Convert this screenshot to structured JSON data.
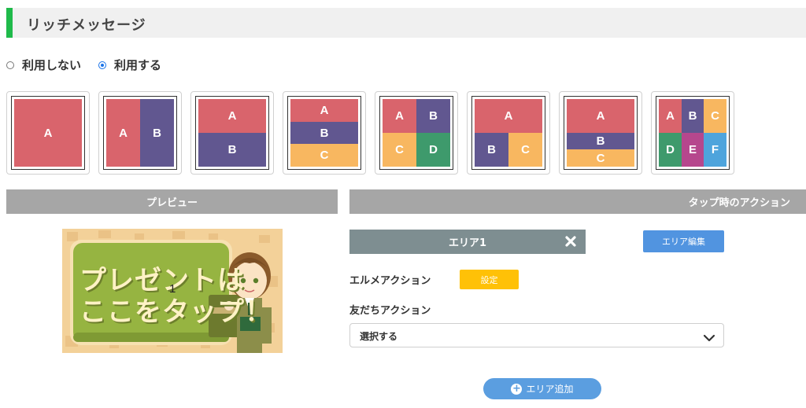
{
  "header": {
    "title": "リッチメッセージ",
    "accent_color": "#1fba4a"
  },
  "mode": {
    "options": [
      {
        "label": "利用しない",
        "checked": false
      },
      {
        "label": "利用する",
        "checked": true
      }
    ]
  },
  "layouts": {
    "colors": {
      "red": "#d9646c",
      "purple": "#615790",
      "orange": "#f8b760",
      "green": "#3e9a6c",
      "magenta": "#b6478d",
      "blue": "#4ea4dc"
    },
    "items": [
      {
        "tiles": [
          "A"
        ]
      },
      {
        "tiles": [
          "A",
          "B"
        ]
      },
      {
        "tiles": [
          "A",
          "B"
        ]
      },
      {
        "tiles": [
          "A",
          "B",
          "C"
        ]
      },
      {
        "tiles": [
          "A",
          "B",
          "C",
          "D"
        ]
      },
      {
        "tiles": [
          "A",
          "B",
          "C"
        ]
      },
      {
        "tiles": [
          "A",
          "B",
          "C"
        ]
      },
      {
        "tiles": [
          "A",
          "B",
          "C",
          "D",
          "E",
          "F"
        ]
      }
    ]
  },
  "preview": {
    "title": "プレビュー",
    "image_text_line1": "プレゼントは",
    "image_text_line2": "ここをタップ！",
    "area_number": "1"
  },
  "actions": {
    "title": "タップ時のアクション",
    "area_label": "エリア1",
    "edit_label": "エリア編集",
    "elme_action_label": "エルメアクション",
    "set_label": "設定",
    "friend_action_label": "友だちアクション",
    "select_value": "選択する",
    "add_area_label": "エリア追加"
  }
}
